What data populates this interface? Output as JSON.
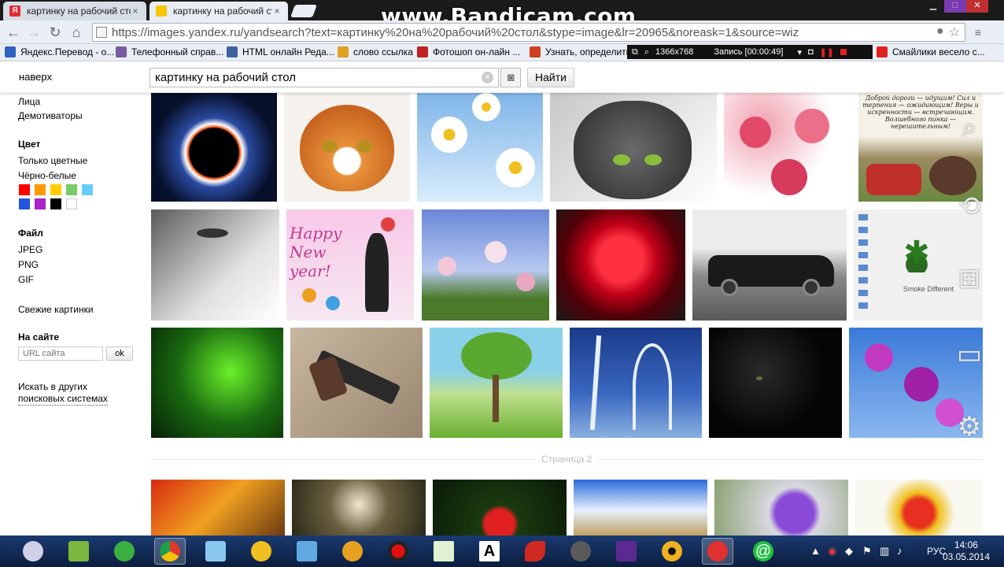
{
  "browser": {
    "tabs": [
      {
        "label": "картинку на рабочий сто",
        "icon": "yandex-tab-icon",
        "color": "#e8292f"
      },
      {
        "label": "картинку на рабочий сто",
        "icon": "yandex-images-tab-icon",
        "color": "#f7c600"
      }
    ],
    "close_glyph": "×",
    "url": "https://images.yandex.ru/yandsearch?text=картинку%20на%20рабочий%20стол&stype=image&lr=20965&noreask=1&source=wiz"
  },
  "watermark": "www.Bandicam.com",
  "bookmarks": [
    {
      "label": "Яндекс.Перевод - о...",
      "color": "#3060c0"
    },
    {
      "label": "Телефонный справ...",
      "color": "#7a5aa0"
    },
    {
      "label": "HTML онлайн Реда...",
      "color": "#4060a0"
    },
    {
      "label": "слово ссылка",
      "color": "#e0a020"
    },
    {
      "label": "Фотошоп он-лайн ...",
      "color": "#c02020"
    },
    {
      "label": "Узнать, определить",
      "color": "#d04020"
    },
    {
      "label": "Смайлики весело с...",
      "color": "#e02020"
    }
  ],
  "recorder": {
    "resolution": "1366x768",
    "status": "Запись [00:00:49]"
  },
  "search": {
    "back_label": "наверх",
    "query": "картинку на рабочий стол",
    "find_label": "Найти"
  },
  "sidebar": {
    "link_faces": "Лица",
    "link_demotivators": "Демотиваторы",
    "color_heading": "Цвет",
    "color_only": "Только цветные",
    "color_bw": "Чёрно-белые",
    "swatches": [
      "#ff0000",
      "#ff9900",
      "#ffcc00",
      "#77cc66",
      "#66ccff",
      "#2255dd",
      "#aa22cc",
      "#000000",
      "#ffffff"
    ],
    "file_heading": "Файл",
    "file_jpeg": "JPEG",
    "file_png": "PNG",
    "file_gif": "GIF",
    "fresh": "Свежие картинки",
    "site_heading": "На сайте",
    "site_placeholder": "URL сайта",
    "ok_label": "ok",
    "other_search_1": "Искать в других",
    "other_search_2": "поисковых системах"
  },
  "results": {
    "thumb_texts": {
      "proverb": "Доброй дороги — идущим! Сил и терпения — ожидающим! Веры и искренности — встречающим. Волшебного пинка — нерешительным!",
      "new_year": "Happy New year!",
      "smoke": "Smoke Different"
    },
    "page2_label": "Страница 2"
  },
  "taskbar": {
    "language": "РУС",
    "time": "14:06",
    "date": "03.05.2014"
  }
}
